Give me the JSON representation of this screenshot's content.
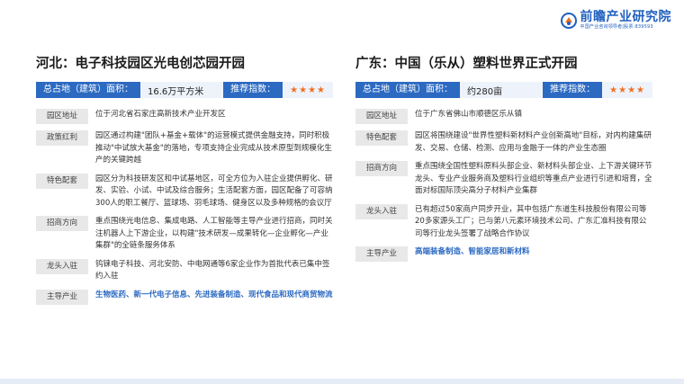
{
  "brand": {
    "name": "前瞻产业研究院",
    "subtitle": "中国产业咨询领导者|股票:839593",
    "colors": {
      "primary": "#2c6ac2",
      "accent": "#f07020",
      "tag_bg": "#e8e8e8"
    }
  },
  "left": {
    "title": "河北：电子科技园区光电创芯园开园",
    "area_label": "总占地（建筑）面积：",
    "area_value": "16.6万平方米",
    "rec_label": "推荐指数：",
    "rating": "★★★★",
    "rows": [
      {
        "tag": "园区地址",
        "text": "位于河北省石家庄高新技术产业开发区"
      },
      {
        "tag": "政策红利",
        "text": "园区通过构建\"团队+基金+载体\"的运营模式提供金融支持，同时积极推动\"中试放大基金\"的落地，专项支持企业完成从技术原型到规模化生产的关键跨越"
      },
      {
        "tag": "特色配套",
        "text": "园区分为科技研发区和中试基地区，可全方位为入驻企业提供孵化、研发、实验、小试、中试及综合服务；生活配套方面，园区配备了可容纳300人的职工餐厅、篮球场、羽毛球场、健身区以及多种规格的会议厅"
      },
      {
        "tag": "招商方向",
        "text": "重点围绕光电信息、集成电路、人工智能等主导产业进行招商，同时关注机器人上下游企业，以构建\"技术研发—成果转化—企业孵化—产业集群\"的全链条服务体系"
      },
      {
        "tag": "龙头入驻",
        "text": "钨铼电子科技、河北安防、中电网通等6家企业作为首批代表已集中签约入驻"
      },
      {
        "tag": "主导产业",
        "text": "生物医药、新一代电子信息、先进装备制造、现代食品和现代商贸物流"
      }
    ]
  },
  "right": {
    "title": "广东：中国（乐从）塑料世界正式开园",
    "area_label": "总占地（建筑）面积：",
    "area_value": "约280亩",
    "rec_label": "推荐指数：",
    "rating": "★★★★",
    "rows": [
      {
        "tag": "园区地址",
        "text": "位于广东省佛山市顺德区乐从镇"
      },
      {
        "tag": "特色配套",
        "text": "园区将围绕建设\"世界性塑料新材料产业创新高地\"目标，对内构建集研发、交易、仓储、检测、应用与金融于一体的产业生态圈"
      },
      {
        "tag": "招商方向",
        "text": "重点围绕全国性塑料原料头部企业、新材料头部企业、上下游关键环节龙头、专业产业服务商及塑料行业组织等重点产业进行引进和培育，全面对标国际顶尖高分子材料产业集群"
      },
      {
        "tag": "龙头入驻",
        "text": "已有超过50家商户同步开业，其中包括广东道生科技股份有限公司等20多家源头工厂；已与第八元素环境技术公司、广东汇准科技有限公司等行业龙头签署了战略合作协议"
      },
      {
        "tag": "主导产业",
        "text": "高端装备制造、智能家居和新材料"
      }
    ]
  }
}
